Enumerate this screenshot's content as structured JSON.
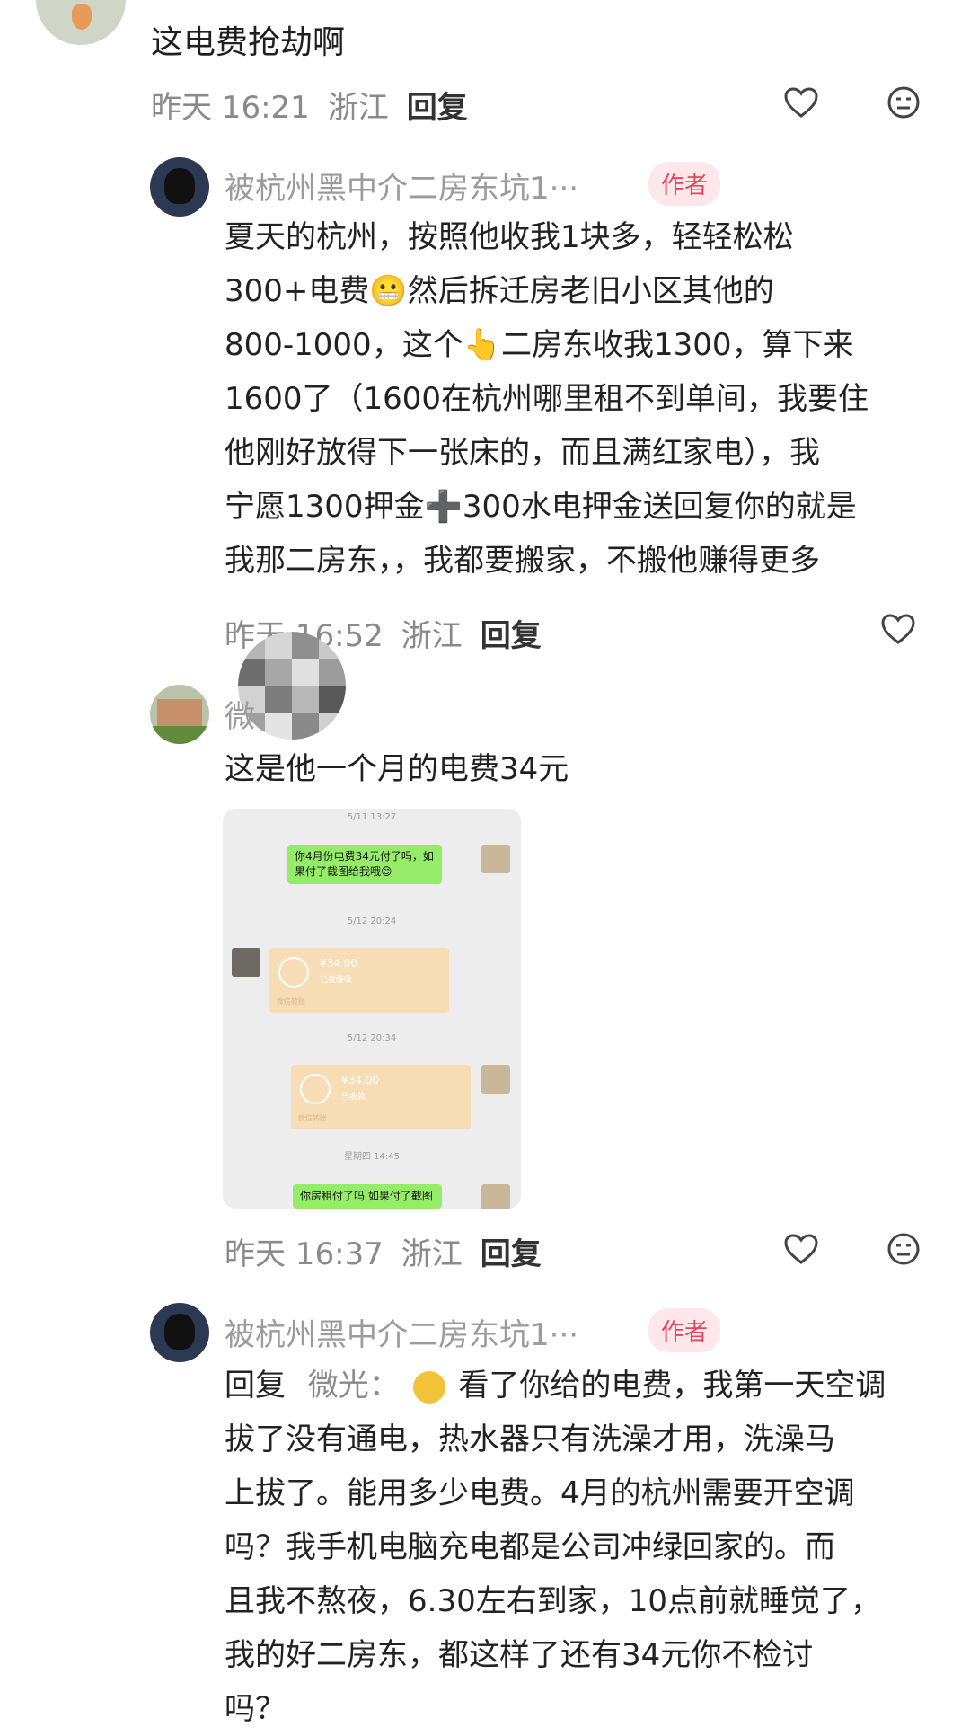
{
  "comments": [
    {
      "text": "这电费抢劫啊",
      "time": "昨天 16:21",
      "location": "浙江",
      "reply_label": "回复"
    },
    {
      "author": "被杭州黑中介二房东坑1···",
      "badge": "作者",
      "lines": [
        "夏天的杭州，按照他收我1块多，轻轻松松",
        "300+电费😬然后拆迁房老旧小区其他的",
        "800-1000，这个👆二房东收我1300，算下来",
        "1600了（1600在杭州哪里租不到单间，我要住",
        "他刚好放得下一张床的，而且满红家电），我",
        "宁愿1300押金➕300水电押金送回复你的就是",
        "我那二房东，，我都要搬家，不搬他赚得更多"
      ],
      "time": "昨天 16:52",
      "location": "浙江",
      "reply_label": "回复"
    },
    {
      "author": "微",
      "text": "这是他一个月的电费34元",
      "time": "昨天 16:37",
      "location": "浙江",
      "reply_label": "回复",
      "image": {
        "ts1": "5/11 13:27",
        "msg1": "你4月份电费34元付了吗，如果付了截图给我哦😊",
        "ts2": "5/12 20:24",
        "amount1": "¥34.00",
        "status1": "已被接收",
        "foot1": "微信转账",
        "ts3": "5/12 20:34",
        "amount2": "¥34.00",
        "status2": "已收款",
        "foot2": "微信转账",
        "ts4": "星期四 14:45",
        "msg2": "你房租付了吗 如果付了截图"
      }
    },
    {
      "author": "被杭州黑中介二房东坑1···",
      "badge": "作者",
      "reply_prefix": "回复",
      "reply_to": "微光：",
      "lines": [
        "看了你给的电费，我第一天空调",
        "拔了没有通电，热水器只有洗澡才用，洗澡马",
        "上拔了。能用多少电费。4月的杭州需要开空调",
        "吗？我手机电脑充电都是公司冲绿回家的。而",
        "且我不熬夜，6.30左右到家，10点前就睡觉了，",
        "我的好二房东，都这样了还有34元你不检讨",
        "吗？"
      ]
    }
  ]
}
